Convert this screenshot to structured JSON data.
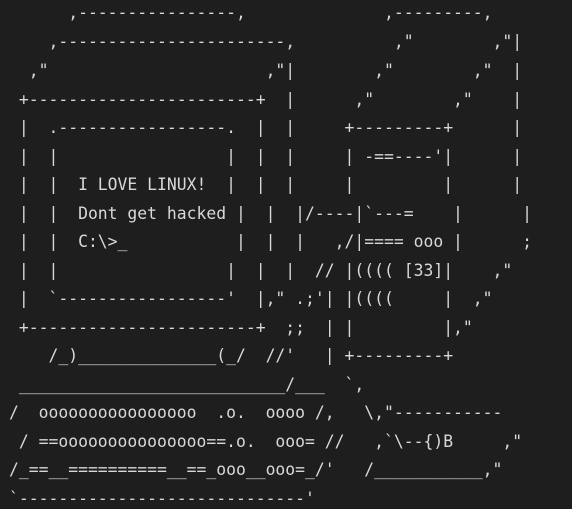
{
  "ascii_art": {
    "lines": [
      "      ,----------------,              ,---------,",
      "    ,-----------------------,          ,\"        ,\"|",
      "  ,\"                      ,\"|        ,\"        ,\"  |",
      " +-----------------------+  |      ,\"        ,\"    |",
      " |  .-----------------.  |  |     +---------+      |",
      " |  |                 |  |  |     | -==----'|      |",
      " |  |  I LOVE LINUX!  |  |  |     |         |      |",
      " |  |  Dont get hacked |  |  |/----|`---=    |      |",
      " |  |  C:\\>_           |  |  |   ,/|==== ooo |      ;",
      " |  |                 |  |  |  // |(((( [33]|    ,\"",
      " |  `-----------------'  |,\" .;'| |((((     |  ,\"",
      " +-----------------------+  ;;  | |         |,\"",
      "    /_)______________(_/  //'   | +---------+",
      " ___________________________/___  `,",
      "/  oooooooooooooooo  .o.  oooo /,   \\,\"-----------",
      " / ==ooooooooooooooo==.o.  ooo= //   ,`\\--{)B     ,\"",
      "/_==__==========__==_ooo__ooo=_/'   /___________,\"",
      "`-----------------------------'"
    ]
  }
}
